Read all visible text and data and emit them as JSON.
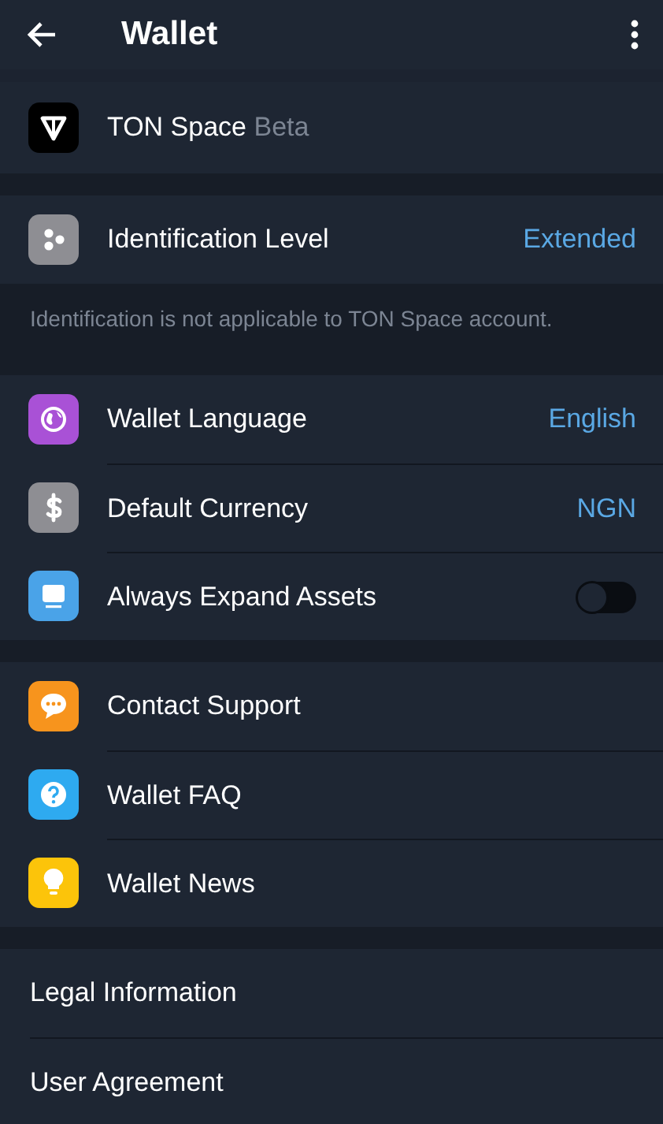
{
  "header": {
    "title": "Wallet"
  },
  "sections": [
    {
      "rows": [
        {
          "kind": "plain",
          "label": "TON Space",
          "badge": "Beta"
        }
      ]
    },
    {
      "rows": [
        {
          "kind": "value",
          "label": "Identification Level",
          "value": "Extended"
        }
      ],
      "note": "Identification is not applicable to TON Space account."
    },
    {
      "rows": [
        {
          "kind": "value",
          "label": "Wallet Language",
          "value": "English"
        },
        {
          "kind": "value",
          "label": "Default Currency",
          "value": "NGN"
        },
        {
          "kind": "toggle",
          "label": "Always Expand Assets",
          "on": false
        }
      ]
    },
    {
      "rows": [
        {
          "kind": "plain",
          "label": "Contact Support"
        },
        {
          "kind": "plain",
          "label": "Wallet FAQ"
        },
        {
          "kind": "plain",
          "label": "Wallet News"
        }
      ]
    },
    {
      "rows": [
        {
          "kind": "plain",
          "label": "Legal Information"
        },
        {
          "kind": "plain",
          "label": "User Agreement"
        }
      ]
    }
  ]
}
